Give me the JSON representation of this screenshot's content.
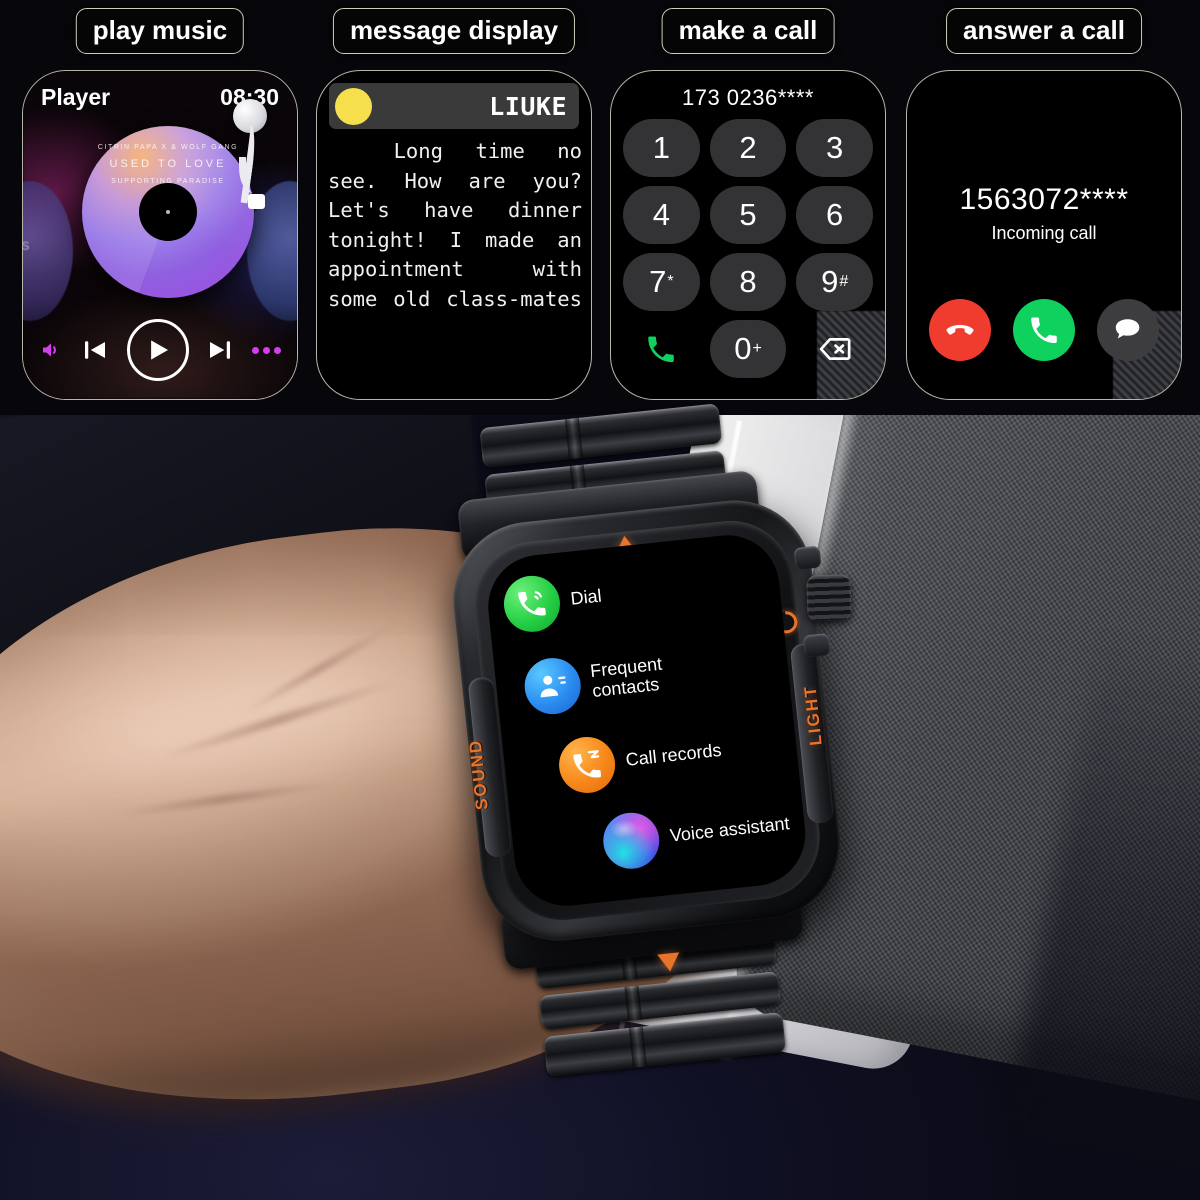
{
  "panels": [
    {
      "tag": "play music",
      "id": "play-music",
      "screen": {
        "app_title": "Player",
        "time": "08:30",
        "album_line1": "CITRIN PAPA X & WOLF GANG",
        "album_line2": "USED TO LOVE",
        "album_line3": "SUPPORTING PARADISE",
        "side_disc_label": "GONS",
        "controls": [
          "volume-icon",
          "previous-icon",
          "play-icon",
          "next-icon",
          "more-icon"
        ]
      }
    },
    {
      "tag": "message display",
      "id": "message-display",
      "screen": {
        "sender": "LIUKE",
        "avatar_color": "#f5df4d",
        "body": "Long time no see. How are you? Let's have dinner tonight! I made an appointment with some old class-mates"
      }
    },
    {
      "tag": "make a call",
      "id": "make-a-call",
      "screen": {
        "number": "173 0236****",
        "keys": [
          {
            "main": "1",
            "sup": ""
          },
          {
            "main": "2",
            "sup": ""
          },
          {
            "main": "3",
            "sup": ""
          },
          {
            "main": "4",
            "sup": ""
          },
          {
            "main": "5",
            "sup": ""
          },
          {
            "main": "6",
            "sup": ""
          },
          {
            "main": "7",
            "sup": "*"
          },
          {
            "main": "8",
            "sup": ""
          },
          {
            "main": "9",
            "sup": "#"
          }
        ],
        "call_icon": "phone-call-icon",
        "zero_key": {
          "main": "0",
          "sup": "+"
        },
        "backspace_icon": "backspace-icon"
      }
    },
    {
      "tag": "answer a call",
      "id": "answer-a-call",
      "screen": {
        "number": "1563072****",
        "status": "Incoming call",
        "buttons": [
          {
            "name": "decline-call-button",
            "icon": "phone-hangup-icon",
            "color": "#f03c2e"
          },
          {
            "name": "accept-call-button",
            "icon": "phone-answer-icon",
            "color": "#0ed15e"
          },
          {
            "name": "reply-message-button",
            "icon": "message-bubble-icon",
            "color": "#3d3d3f"
          }
        ]
      }
    }
  ],
  "watch": {
    "case_left_text": "SOUND",
    "case_right_text": "LIGHT",
    "power_icon": "power-icon",
    "crown": "rotating-crown",
    "menu": [
      {
        "label": "Dial",
        "icon": "phone-dial-icon",
        "color": "#25cf45"
      },
      {
        "label": "Frequent\ncontacts",
        "icon": "contacts-icon",
        "color": "#2b8cf0"
      },
      {
        "label": "Call records",
        "icon": "call-log-icon",
        "color": "#f7871a"
      },
      {
        "label": "Voice assistant",
        "icon": "voice-assistant-icon",
        "color": "#7b3bd6"
      }
    ]
  },
  "theme": {
    "accent_orange": "#e8742a",
    "background_navy": "#12122a",
    "tag_border": "#cfcabb"
  }
}
